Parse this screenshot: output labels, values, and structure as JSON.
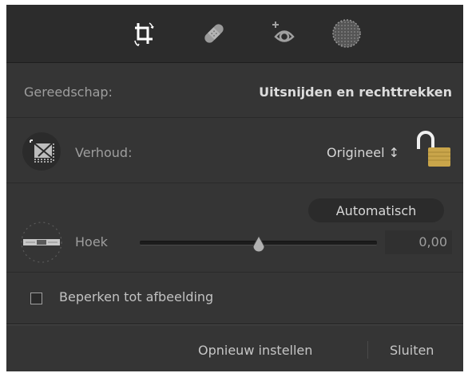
{
  "toolstrip": {
    "tools": [
      {
        "name": "crop-icon",
        "active": true
      },
      {
        "name": "bandage-icon",
        "active": false
      },
      {
        "name": "red-eye-icon",
        "active": false
      },
      {
        "name": "radial-mask-icon",
        "active": false
      }
    ]
  },
  "tool_row": {
    "label": "Gereedschap:",
    "value": "Uitsnijden en rechttrekken"
  },
  "aspect_row": {
    "label": "Verhoud:",
    "value": "Origineel ↕",
    "lock_icon": "padlock-open-icon"
  },
  "angle_row": {
    "auto_label": "Automatisch",
    "label": "Hoek",
    "value": "0,00",
    "slider_fraction": 0.5
  },
  "constrain": {
    "label": "Beperken tot afbeelding",
    "checked": false
  },
  "footer": {
    "reset_label": "Opnieuw instellen",
    "close_label": "Sluiten"
  },
  "colors": {
    "panel": "#353535",
    "toolbar": "#2c2c2c",
    "lock_gold": "#c9a54a"
  }
}
